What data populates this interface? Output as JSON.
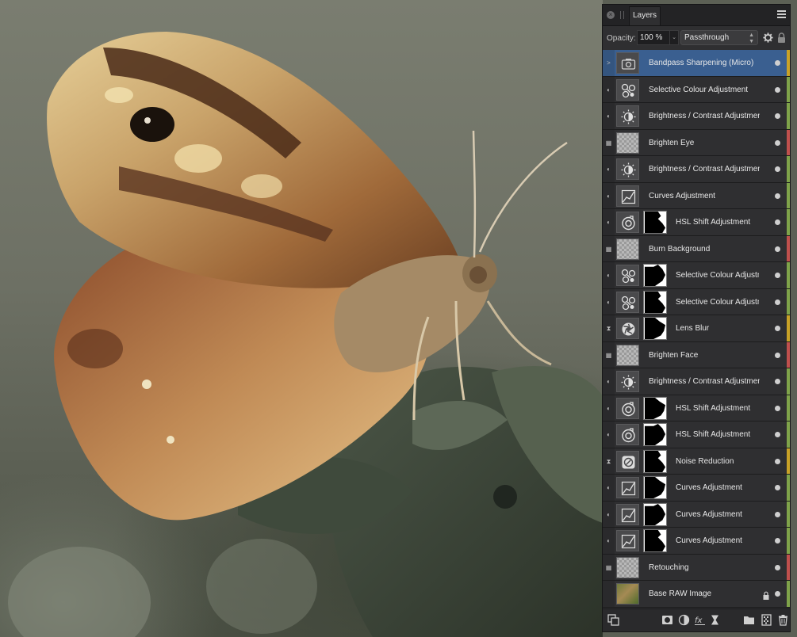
{
  "panel": {
    "tab_label": "Layers",
    "opacity_label": "Opacity:",
    "opacity_value": "100 %",
    "blend_mode": "Passthrough",
    "selected_color": "#3a5f90"
  },
  "layers": [
    {
      "name": "Bandpass Sharpening (Micro)",
      "icon": "camera-icon",
      "type": "adj",
      "mask": false,
      "status": ">",
      "color": "#c9a227",
      "selected": true
    },
    {
      "name": "Selective Colour Adjustment",
      "icon": "selective-colour-icon",
      "type": "adj",
      "mask": false,
      "status": "◐",
      "color": "#7fa34a"
    },
    {
      "name": "Brightness / Contrast Adjustment",
      "icon": "brightness-icon",
      "type": "adj",
      "mask": false,
      "status": "◐",
      "color": "#7fa34a"
    },
    {
      "name": "Brighten Eye",
      "icon": "pixel-layer-icon",
      "type": "pixel",
      "mask": false,
      "status": "▦",
      "color": "#c0504d"
    },
    {
      "name": "Brightness / Contrast Adjustment",
      "icon": "brightness-icon",
      "type": "adj",
      "mask": false,
      "status": "◐",
      "color": "#7fa34a"
    },
    {
      "name": "Curves Adjustment",
      "icon": "curves-icon",
      "type": "adj",
      "mask": false,
      "status": "◐",
      "color": "#7fa34a"
    },
    {
      "name": "HSL Shift Adjustment",
      "icon": "hsl-icon",
      "type": "adj",
      "mask": true,
      "status": "◐",
      "color": "#7fa34a"
    },
    {
      "name": "Burn Background",
      "icon": "pixel-layer-icon",
      "type": "pixel",
      "mask": false,
      "status": "▦",
      "color": "#c0504d"
    },
    {
      "name": "Selective Colour Adjustment",
      "icon": "selective-colour-icon",
      "type": "adj",
      "mask": true,
      "status": "◐",
      "color": "#7fa34a"
    },
    {
      "name": "Selective Colour Adjustment",
      "icon": "selective-colour-icon",
      "type": "adj",
      "mask": true,
      "status": "◐",
      "color": "#7fa34a"
    },
    {
      "name": "Lens Blur",
      "icon": "lens-blur-icon",
      "type": "adj",
      "mask": true,
      "status": "⧗",
      "color": "#c9a227"
    },
    {
      "name": "Brighten Face",
      "icon": "pixel-layer-icon",
      "type": "pixel",
      "mask": false,
      "status": "▦",
      "color": "#c0504d"
    },
    {
      "name": "Brightness / Contrast Adjustment",
      "icon": "brightness-icon",
      "type": "adj",
      "mask": false,
      "status": "◐",
      "color": "#7fa34a"
    },
    {
      "name": "HSL Shift Adjustment",
      "icon": "hsl-icon",
      "type": "adj",
      "mask": true,
      "status": "◐",
      "color": "#7fa34a"
    },
    {
      "name": "HSL Shift Adjustment",
      "icon": "hsl-icon",
      "type": "adj",
      "mask": true,
      "status": "◐",
      "color": "#7fa34a"
    },
    {
      "name": "Noise Reduction",
      "icon": "noise-reduction-icon",
      "type": "adj",
      "mask": true,
      "status": "⧗",
      "color": "#c9a227"
    },
    {
      "name": "Curves Adjustment",
      "icon": "curves-icon",
      "type": "adj",
      "mask": true,
      "status": "◐",
      "color": "#7fa34a"
    },
    {
      "name": "Curves Adjustment",
      "icon": "curves-icon",
      "type": "adj",
      "mask": true,
      "status": "◐",
      "color": "#7fa34a"
    },
    {
      "name": "Curves Adjustment",
      "icon": "curves-icon",
      "type": "adj",
      "mask": true,
      "status": "◐",
      "color": "#7fa34a"
    },
    {
      "name": "Retouching",
      "icon": "pixel-layer-icon",
      "type": "pixel",
      "mask": false,
      "status": "▦",
      "color": "#c0504d"
    },
    {
      "name": "Base RAW Image",
      "icon": "image-layer-icon",
      "type": "image",
      "mask": false,
      "status": "",
      "color": "#7fa34a",
      "locked": true
    }
  ],
  "toolbar_icons": [
    "layer-stack-icon",
    "mask-icon",
    "adjustment-icon",
    "fx-icon",
    "live-filter-icon",
    "folder-icon",
    "pixel-layer-icon",
    "trash-icon"
  ]
}
